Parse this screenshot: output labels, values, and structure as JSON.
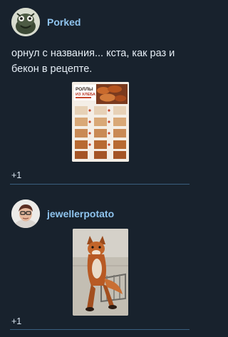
{
  "posts": [
    {
      "username": "Porked",
      "text": "орнул с названия... кста, как раз и бекон в рецепте.",
      "media": {
        "type": "image",
        "title_line1": "РОЛЛЫ",
        "title_line2": "ИЗ ХЛЕБА"
      },
      "reactions": "+1"
    },
    {
      "username": "jewellerpotato",
      "media": {
        "type": "image"
      },
      "reactions": "+1"
    }
  ],
  "colors": {
    "background": "#18222d",
    "username": "#8fc4ee",
    "divider": "#3a5f80"
  }
}
